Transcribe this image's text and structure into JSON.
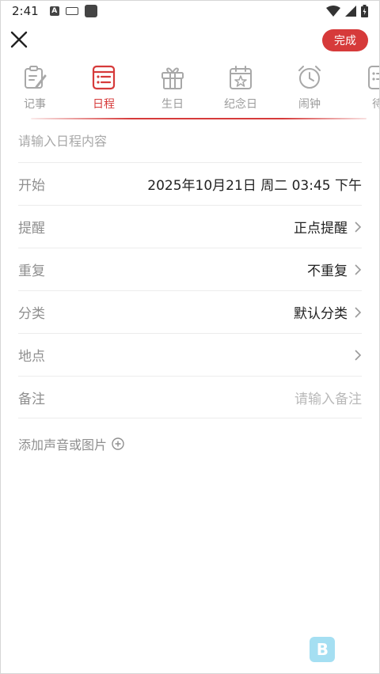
{
  "status_bar": {
    "time": "2:41"
  },
  "header": {
    "done_label": "完成"
  },
  "tabs": [
    {
      "label": "记事",
      "icon": "note-edit-icon",
      "active": false
    },
    {
      "label": "日程",
      "icon": "schedule-list-icon",
      "active": true
    },
    {
      "label": "生日",
      "icon": "gift-icon",
      "active": false
    },
    {
      "label": "纪念日",
      "icon": "calendar-star-icon",
      "active": false
    },
    {
      "label": "闹钟",
      "icon": "alarm-clock-icon",
      "active": false
    },
    {
      "label": "待",
      "icon": "todo-icon",
      "active": false
    }
  ],
  "form": {
    "content_placeholder": "请输入日程内容",
    "start": {
      "label": "开始",
      "value": "2025年10月21日 周二 03:45 下午"
    },
    "reminder": {
      "label": "提醒",
      "value": "正点提醒"
    },
    "repeat": {
      "label": "重复",
      "value": "不重复"
    },
    "category": {
      "label": "分类",
      "value": "默认分类"
    },
    "location": {
      "label": "地点",
      "value": ""
    },
    "note": {
      "label": "备注",
      "placeholder": "请输入备注"
    },
    "add_media_label": "添加声音或图片"
  },
  "colors": {
    "accent": "#d63a3a",
    "inactive": "#9a9a9a"
  }
}
